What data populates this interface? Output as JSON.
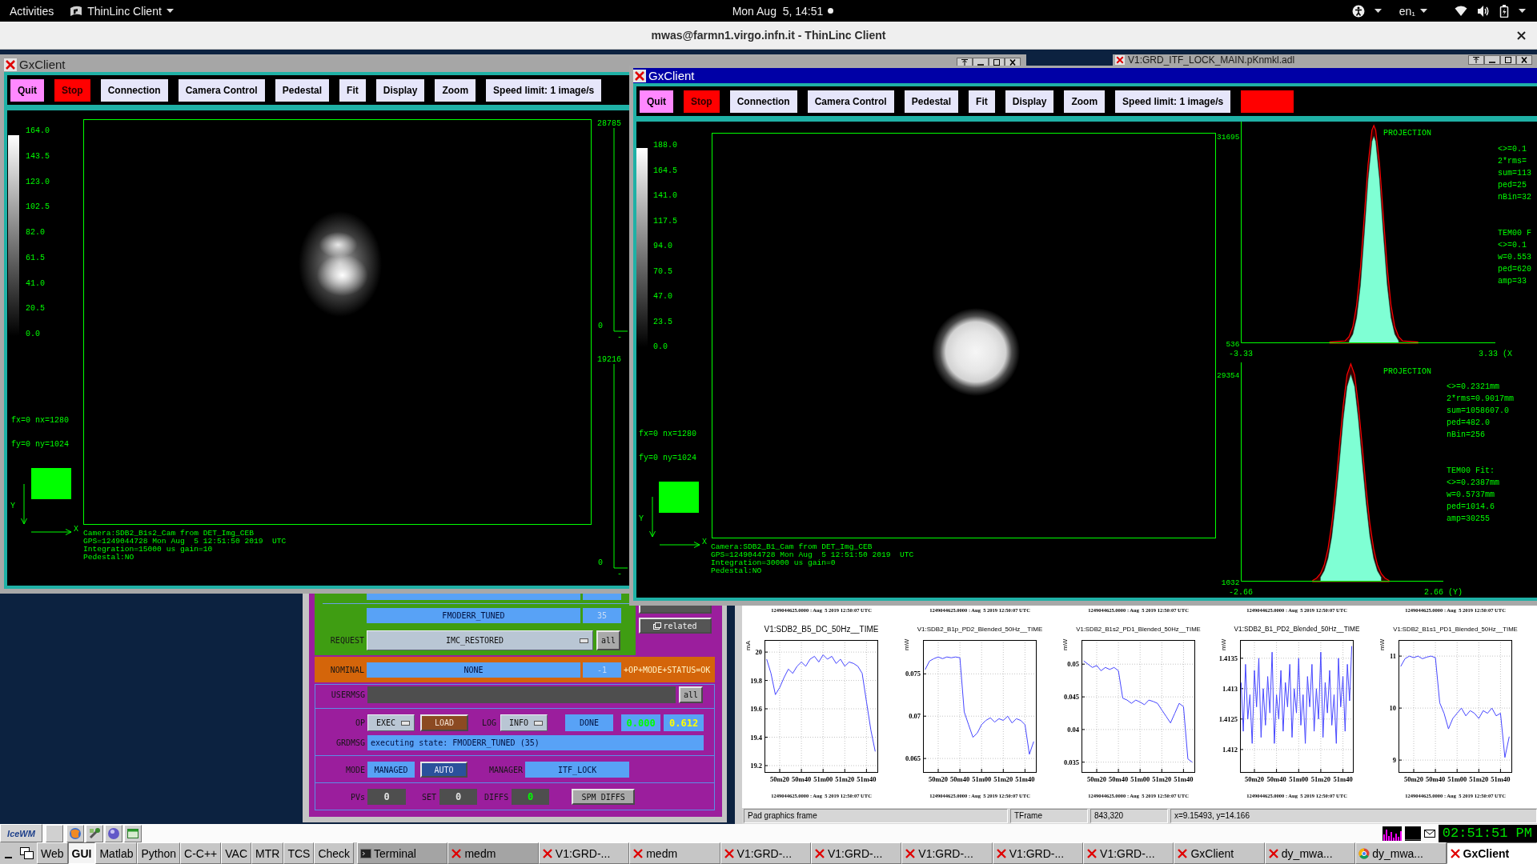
{
  "top_bar": {
    "activities": "Activities",
    "app_menu": "ThinLinc Client",
    "clock": "Mon Aug  5, 14:51",
    "notification": true,
    "keyboard_layout": "en₁"
  },
  "client_window": {
    "title": "mwas@farmn1.virgo.infn.it - ThinLinc Client"
  },
  "background_window": {
    "title": "V1:GRD_ITF_LOCK_MAIN.pKnmkl.adl"
  },
  "camera_windows": [
    {
      "title": "GxClient",
      "focused": false,
      "buttons": [
        {
          "label": "Quit",
          "kind": "quit"
        },
        {
          "label": "Stop",
          "kind": "stop"
        },
        {
          "label": "Connection",
          "kind": "plain"
        },
        {
          "label": "Camera Control",
          "kind": "plain"
        },
        {
          "label": "Pedestal",
          "kind": "plain"
        },
        {
          "label": "Fit",
          "kind": "plain"
        },
        {
          "label": "Display",
          "kind": "plain"
        },
        {
          "label": "Zoom",
          "kind": "plain"
        },
        {
          "label": "Speed limit: 1 image/s",
          "kind": "plain"
        }
      ],
      "colorbar_labels": [
        "164.0",
        "143.5",
        "123.0",
        "102.5",
        "82.0",
        "61.5",
        "41.0",
        "20.5",
        "0.0"
      ],
      "frame_labels": [
        "fx=0 nx=1280",
        "fy=0 ny=1024"
      ],
      "axes": {
        "x": "X",
        "y": "Y"
      },
      "beam": {
        "kind": "speckled"
      },
      "info_lines": [
        "Camera:SDB2_B1s2_Cam from DET_Img_CEB",
        "GPS=1249044728 Mon Aug  5 12:51:50 2019  UTC",
        "Integration=15000 us gain=10",
        "Pedestal:NO"
      ],
      "projections": [
        {
          "max": "28785",
          "min": "0",
          "low": "-"
        },
        {
          "max": "19216",
          "min": "0",
          "low": "-"
        }
      ]
    },
    {
      "title": "GxClient",
      "focused": true,
      "alarm": true,
      "buttons": [
        {
          "label": "Quit",
          "kind": "quit"
        },
        {
          "label": "Stop",
          "kind": "stop"
        },
        {
          "label": "Connection",
          "kind": "plain"
        },
        {
          "label": "Camera Control",
          "kind": "plain"
        },
        {
          "label": "Pedestal",
          "kind": "plain"
        },
        {
          "label": "Fit",
          "kind": "plain"
        },
        {
          "label": "Display",
          "kind": "plain"
        },
        {
          "label": "Zoom",
          "kind": "plain"
        },
        {
          "label": "Speed limit: 1 image/s",
          "kind": "plain"
        }
      ],
      "colorbar_labels": [
        "188.0",
        "164.5",
        "141.0",
        "117.5",
        "94.0",
        "70.5",
        "47.0",
        "23.5",
        "0.0"
      ],
      "frame_labels": [
        "fx=0 nx=1280",
        "fy=0 ny=1024"
      ],
      "axes": {
        "x": "X",
        "y": "Y"
      },
      "beam": {
        "kind": "round"
      },
      "info_lines": [
        "Camera:SDB2_B1_Cam from DET_Img_CEB",
        "GPS=1249044728 Mon Aug  5 12:51:50 2019  UTC",
        "Integration=30000 us gain=0",
        "Pedestal:NO"
      ],
      "projections": [
        {
          "chart_data": {
            "type": "area",
            "title": "PROJECTION",
            "x": [
              -1,
              -0.6,
              -0.5,
              -0.4,
              -0.3,
              -0.2,
              -0.1,
              0,
              0.1,
              0.15,
              0.2,
              0.3,
              0.4,
              0.5,
              0.6,
              0.7,
              0.8,
              0.9,
              1.3
            ],
            "series": [
              {
                "color": "#7fffd4",
                "values": [
                  null,
                  null,
                  900,
                  1900,
                  4400,
                  9300,
                  16900,
                  25200,
                  30900,
                  31700,
                  30900,
                  25200,
                  16900,
                  9300,
                  4400,
                  1900,
                  900,
                  null,
                  null
                ]
              },
              {
                "color": "#ff0000",
                "values": [
                  700,
                  900,
                  1500,
                  3000,
                  6300,
                  11900,
                  19600,
                  27500,
                  32600,
                  33300,
                  32600,
                  27500,
                  19600,
                  11900,
                  6300,
                  3000,
                  1500,
                  900,
                  700
                ]
              }
            ],
            "xlim": [
              -3.33,
              3.33
            ],
            "ylim": [
              536,
              34000
            ],
            "xticks": [
              {
                "value": -3.33,
                "label": "-3.33"
              },
              {
                "value": 3.33,
                "label": "3.33 (X"
              }
            ],
            "yticks": [
              536,
              31695
            ]
          },
          "stats": [
            "<>=0.1",
            "2*rms=",
            "sum=113",
            "ped=25",
            "nBin=32"
          ],
          "fit": [
            "TEM00 F",
            "<>=0.1",
            "w=0.553",
            "ped=620",
            "amp=33"
          ]
        },
        {
          "chart_data": {
            "type": "area",
            "title": "PROJECTION",
            "x": [
              -0.77,
              -0.67,
              -0.57,
              -0.47,
              -0.37,
              -0.27,
              -0.17,
              -0.07,
              0.03,
              0.13,
              0.23,
              0.33,
              0.43,
              0.53,
              0.63,
              0.73,
              0.83,
              0.93,
              1.03,
              1.13,
              1.23
            ],
            "series": [
              {
                "color": "#7fffd4",
                "values": [
                  null,
                  null,
                  1600,
                  2500,
                  4200,
                  7200,
                  11800,
                  17400,
                  23200,
                  27700,
                  29400,
                  27700,
                  23200,
                  17400,
                  11800,
                  7200,
                  4200,
                  2500,
                  1600,
                  null,
                  null
                ]
              },
              {
                "color": "#ff0000",
                "values": [
                  1200,
                  1500,
                  2100,
                  3300,
                  5500,
                  9000,
                  13800,
                  19600,
                  25100,
                  29300,
                  30800,
                  29300,
                  25100,
                  19600,
                  13800,
                  9000,
                  5500,
                  3300,
                  2100,
                  1500,
                  1200
                ]
              }
            ],
            "xlim": [
              -2.66,
              2.66
            ],
            "ylim": [
              1032,
              31000
            ],
            "xticks": [
              {
                "value": -2.66,
                "label": "-2.66"
              },
              {
                "value": 2.66,
                "label": "2.66 (Y)"
              }
            ],
            "yticks": [
              1032,
              29354
            ]
          },
          "stats": [
            "<>=0.2321mm",
            "2*rms=0.9017mm",
            "sum=1058607.0",
            "ped=482.0",
            "nBin=256"
          ],
          "fit": [
            "TEM00 Fit:",
            "<>=0.2387mm",
            "w=0.5737mm",
            "ped=1014.6",
            "amp=30255"
          ]
        }
      ]
    }
  ],
  "guardian": {
    "state": {
      "name": "FMODERR_TUNED",
      "index": "35"
    },
    "request": {
      "label": "REQUEST",
      "value": "IMC_RESTORED",
      "button": "all"
    },
    "side_buttons": [
      "related"
    ],
    "nominal": {
      "label": "NOMINAL",
      "value": "NONE",
      "index": "-1",
      "status": "+OP+MODE+STATUS=OK"
    },
    "usermsg": {
      "label": "USERMSG",
      "button": "all"
    },
    "op": {
      "label": "OP",
      "value": "EXEC",
      "load": "LOAD",
      "log_label": "LOG",
      "log_value": "INFO",
      "done": "DONE"
    },
    "readouts": [
      {
        "value": "0.000",
        "color": "#00ff00"
      },
      {
        "value": "0.612",
        "color": "#ffff00"
      }
    ],
    "grdmsg": {
      "label": "GRDMSG",
      "value": "executing state: FMODERR_TUNED (35)"
    },
    "mode": {
      "label": "MODE",
      "value": "MANAGED",
      "button": "AUTO",
      "manager_label": "MANAGER",
      "manager": "ITF_LOCK"
    },
    "counts": [
      {
        "label": "PVs",
        "value": "0",
        "color": "#e0e0e0"
      },
      {
        "label": "SET",
        "value": "0",
        "color": "#e0e0e0"
      },
      {
        "label": "DIFFS",
        "value": "0",
        "color": "#00ff00"
      }
    ],
    "diff_button": "SPM DIFFS"
  },
  "plot_canvas": {
    "plots": [
      {
        "header": "1249044625.0000 : Aug  5 2019 12:50:07 UTC",
        "footer": "1249044625.0000 : Aug  5 2019 12:50:07 UTC",
        "chart_data": {
          "type": "line",
          "title": "V1:SDB2_B5_DC_50Hz__TIME",
          "ylabel": "mA",
          "grid": true,
          "categories": [
            null,
            null,
            null,
            "50m20",
            null,
            null,
            null,
            null,
            "50m40",
            null,
            null,
            null,
            null,
            "51m00",
            null,
            null,
            null,
            null,
            "51m20",
            null,
            null,
            null,
            null,
            "51m40",
            null,
            null
          ],
          "values": [
            19.95,
            19.85,
            19.7,
            19.75,
            19.82,
            19.88,
            19.85,
            19.9,
            19.93,
            19.9,
            19.95,
            19.97,
            19.93,
            19.98,
            19.95,
            19.97,
            19.92,
            19.95,
            19.9,
            19.93,
            19.92,
            19.9,
            19.85,
            19.65,
            19.45,
            19.3
          ],
          "ylim": [
            19.155,
            20.085
          ],
          "yticks": [
            19.2,
            19.4,
            19.6,
            19.8,
            20
          ]
        }
      },
      {
        "header": "1249044625.0000 : Aug  5 2019 12:50:07 UTC",
        "footer": "1249044625.0000 : Aug  5 2019 12:50:07 UTC",
        "chart_data": {
          "type": "line",
          "title": "V1:SDB2_B1p_PD2_Blended_50Hz__TIME",
          "ylabel": "mW",
          "grid": true,
          "categories": [
            null,
            null,
            null,
            "50m20",
            null,
            null,
            null,
            null,
            "50m40",
            null,
            null,
            null,
            null,
            "51m00",
            null,
            null,
            null,
            null,
            "51m20",
            null,
            null,
            null,
            null,
            "51m40",
            null,
            null
          ],
          "values": [
            0.0755,
            0.0765,
            0.0768,
            0.077,
            0.0768,
            0.077,
            0.0769,
            0.077,
            0.0769,
            0.0705,
            0.069,
            0.0675,
            0.068,
            0.069,
            0.0695,
            0.0698,
            0.0693,
            0.0697,
            0.0695,
            0.07,
            0.0692,
            0.0697,
            0.0695,
            0.069,
            0.0655,
            0.067
          ],
          "ylim": [
            0.0634,
            0.079
          ],
          "yticks": [
            0.065,
            0.07,
            0.075
          ]
        }
      },
      {
        "header": "1249044625.0000 : Aug  5 2019 12:50:07 UTC",
        "footer": "1249044625.0000 : Aug  5 2019 12:50:07 UTC",
        "chart_data": {
          "type": "line",
          "title": "V1:SDB2_B1s2_PD1_Blended_50Hz__TIME",
          "ylabel": "mW",
          "grid": true,
          "categories": [
            null,
            null,
            null,
            "50m20",
            null,
            null,
            null,
            null,
            "50m40",
            null,
            null,
            null,
            null,
            "51m00",
            null,
            null,
            null,
            null,
            "51m20",
            null,
            null,
            null,
            null,
            "51m40",
            null,
            null
          ],
          "values": [
            0.0505,
            0.05,
            0.0495,
            0.0498,
            0.049,
            0.0495,
            0.0492,
            0.0495,
            0.049,
            0.0448,
            0.0445,
            0.044,
            0.0445,
            0.0442,
            0.0438,
            0.0445,
            0.0443,
            0.044,
            0.043,
            0.042,
            0.041,
            0.0425,
            0.044,
            0.0435,
            0.0355,
            0.035
          ],
          "ylim": [
            0.0335,
            0.0537
          ],
          "yticks": [
            0.035,
            0.04,
            0.045,
            0.05
          ]
        }
      },
      {
        "header": "1249044625.0000 : Aug  5 2019 12:50:07 UTC",
        "footer": "1249044625.0000 : Aug  5 2019 12:50:07 UTC",
        "chart_data": {
          "type": "line",
          "title": "V1:SDB2_B1_PD2_Blended_50Hz__TIME",
          "ylabel": "mW",
          "grid": true,
          "categories": [
            null,
            null,
            null,
            null,
            null,
            null,
            "50m20",
            null,
            null,
            null,
            null,
            null,
            null,
            null,
            null,
            null,
            "50m40",
            null,
            null,
            null,
            null,
            null,
            null,
            null,
            null,
            null,
            "51m00",
            null,
            null,
            null,
            null,
            null,
            null,
            null,
            null,
            null,
            "51m20",
            null,
            null,
            null,
            null,
            null,
            null,
            null,
            null,
            null,
            "51m40",
            null,
            null,
            null,
            null
          ],
          "values": [
            1.4131,
            1.4123,
            1.4134,
            1.4125,
            1.4129,
            1.4121,
            1.4133,
            1.4127,
            1.4135,
            1.4122,
            1.413,
            1.4124,
            1.4132,
            1.4126,
            1.4136,
            1.4121,
            1.4129,
            1.4125,
            1.4133,
            1.4123,
            1.4131,
            1.4127,
            1.4134,
            1.4122,
            1.413,
            1.4126,
            1.4135,
            1.4124,
            1.4129,
            1.4121,
            1.4132,
            1.4127,
            1.4134,
            1.4123,
            1.413,
            1.4125,
            1.4136,
            1.4122,
            1.4131,
            1.4126,
            1.4133,
            1.4124,
            1.4129,
            1.4121,
            1.4135,
            1.4127,
            1.4132,
            1.4123,
            1.4134,
            1.4128,
            1.4137
          ],
          "ylim": [
            1.41163,
            1.4138
          ],
          "yticks": [
            1.412,
            1.4125,
            1.413,
            1.4135
          ]
        }
      },
      {
        "header": "1249044625.0000 : Aug  5 2019 12:50:07 UTC",
        "footer": "1249044625.0000 : Aug  5 2019 12:50:07 UTC",
        "chart_data": {
          "type": "line",
          "title": "V1:SDB2_B1s1_PD1_Blended_50Hz__TIME",
          "ylabel": "mW",
          "grid": true,
          "categories": [
            null,
            null,
            null,
            "50m20",
            null,
            null,
            null,
            null,
            "50m40",
            null,
            null,
            null,
            null,
            "51m00",
            null,
            null,
            null,
            null,
            "51m20",
            null,
            null,
            null,
            null,
            "51m40",
            null,
            null
          ],
          "values": [
            10.8,
            10.95,
            11,
            10.97,
            11,
            10.95,
            10.98,
            11,
            10.97,
            10.1,
            9.9,
            9.6,
            9.8,
            9.9,
            10,
            9.85,
            9.95,
            9.9,
            9.8,
            9.95,
            9.9,
            10,
            9.85,
            9.9,
            9.05,
            9.45
          ],
          "ylim": [
            8.77,
            11.31
          ],
          "yticks": [
            9,
            10,
            11
          ]
        }
      }
    ],
    "status_bar": [
      "Pad graphics frame",
      "TFrame",
      "843,320",
      "x=9.15493, y=14.166"
    ]
  },
  "taskbar": {
    "start_label": "IceWM",
    "workspaces": [
      {
        "label": "Web",
        "selected": false
      },
      {
        "label": "GUI",
        "selected": true
      },
      {
        "label": "Matlab",
        "selected": false
      },
      {
        "label": "Python",
        "selected": false
      },
      {
        "label": "C-C++",
        "selected": false
      },
      {
        "label": "VAC",
        "selected": false
      },
      {
        "label": "MTR",
        "selected": false
      },
      {
        "label": "TCS",
        "selected": false
      },
      {
        "label": "Check",
        "selected": false
      }
    ],
    "tasks": [
      {
        "label": "Terminal",
        "kind": "terminal",
        "minimized": true,
        "selected": false
      },
      {
        "label": "medm",
        "kind": "x",
        "minimized": true,
        "selected": false
      },
      {
        "label": "V1:GRD-...",
        "kind": "x",
        "minimized": false,
        "selected": false
      },
      {
        "label": "medm",
        "kind": "x",
        "minimized": false,
        "selected": false
      },
      {
        "label": "V1:GRD-...",
        "kind": "x",
        "minimized": false,
        "selected": false
      },
      {
        "label": "V1:GRD-...",
        "kind": "x",
        "minimized": false,
        "selected": false
      },
      {
        "label": "V1:GRD-...",
        "kind": "x",
        "minimized": false,
        "selected": false
      },
      {
        "label": "V1:GRD-...",
        "kind": "x",
        "minimized": false,
        "selected": false
      },
      {
        "label": "V1:GRD-...",
        "kind": "x",
        "minimized": false,
        "selected": false
      },
      {
        "label": "GxClient",
        "kind": "x",
        "minimized": false,
        "selected": false
      },
      {
        "label": "dy_mwa...",
        "kind": "x",
        "minimized": false,
        "selected": false
      },
      {
        "label": "dy_mwa...",
        "kind": "browser",
        "minimized": false,
        "selected": false
      },
      {
        "label": "GxClient",
        "kind": "x",
        "minimized": false,
        "selected": true
      }
    ],
    "clock": "02:51:51 PM"
  }
}
